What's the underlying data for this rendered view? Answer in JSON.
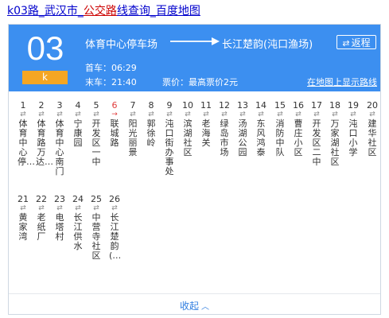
{
  "page_title": {
    "route": "k03路",
    "sep1": "_",
    "city": "武汉市",
    "sep2": "_",
    "bus_kw": "公交路",
    "rest": "线查询",
    "sep3": "_",
    "map": "百度地图"
  },
  "header": {
    "route_number": "03",
    "route_badge": "k",
    "from": "体育中心停车场",
    "to": "长江楚韵(沌口渔场)",
    "return_button": "返程",
    "return_icon": "swap-icon",
    "first_bus": "首车：06:29",
    "last_bus": "末车：21:40",
    "fare": "票价：最高票价2元",
    "map_link": "在地图上显示路线",
    "bg_color": "#3c8ff0",
    "badge_color": "#f5a623"
  },
  "stops": [
    {
      "num": "1",
      "name": "体育中心停…",
      "current": false
    },
    {
      "num": "2",
      "name": "体育路万达…",
      "current": false
    },
    {
      "num": "3",
      "name": "体育中心南门",
      "current": false
    },
    {
      "num": "4",
      "name": "宁康园",
      "current": false
    },
    {
      "num": "5",
      "name": "开发区一中",
      "current": false
    },
    {
      "num": "6",
      "name": "联城路",
      "current": true
    },
    {
      "num": "7",
      "name": "阳光丽景",
      "current": false
    },
    {
      "num": "8",
      "name": "郭徐岭",
      "current": false
    },
    {
      "num": "9",
      "name": "沌口街办事处",
      "current": false
    },
    {
      "num": "10",
      "name": "滨湖社区",
      "current": false
    },
    {
      "num": "11",
      "name": "老海关",
      "current": false
    },
    {
      "num": "12",
      "name": "绿岛市场",
      "current": false
    },
    {
      "num": "13",
      "name": "汤湖公园",
      "current": false
    },
    {
      "num": "14",
      "name": "东风鸿泰",
      "current": false
    },
    {
      "num": "15",
      "name": "消防中队",
      "current": false
    },
    {
      "num": "16",
      "name": "曹庄小区",
      "current": false
    },
    {
      "num": "17",
      "name": "开发区二中",
      "current": false
    },
    {
      "num": "18",
      "name": "万家湖社区",
      "current": false
    },
    {
      "num": "19",
      "name": "沌口小学",
      "current": false
    },
    {
      "num": "20",
      "name": "建华社区",
      "current": false
    },
    {
      "num": "21",
      "name": "黄家湾",
      "current": false
    },
    {
      "num": "22",
      "name": "老纸厂",
      "current": false
    },
    {
      "num": "23",
      "name": "电塔村",
      "current": false
    },
    {
      "num": "24",
      "name": "长江供水",
      "current": false
    },
    {
      "num": "25",
      "name": "中营寺社区",
      "current": false
    },
    {
      "num": "26",
      "name": "长江楚韵(…",
      "current": false
    }
  ],
  "collapse": {
    "label": "收起",
    "icon": "chevron-up-icon"
  }
}
